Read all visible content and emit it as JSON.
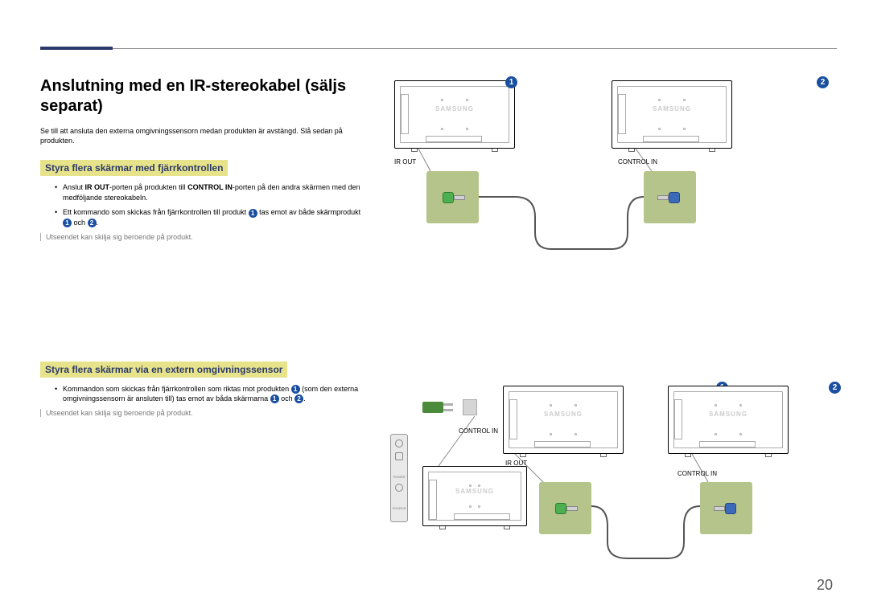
{
  "heading": "Anslutning med en IR-stereokabel (säljs separat)",
  "intro": "Se till att ansluta den externa omgivningssensorn medan produkten är avstängd. Slå sedan på produkten.",
  "section1": {
    "title": "Styra flera skärmar med fjärrkontrollen",
    "bullets": [
      {
        "pre": "Anslut ",
        "b1": "IR OUT",
        "mid": "-porten på produkten till ",
        "b2": "CONTROL IN",
        "post": "-porten på den andra skärmen med den medföljande stereokabeln."
      },
      {
        "pre": "Ett kommando som skickas från fjärrkontrollen till produkt ",
        "n1": "1",
        "mid": " tas emot av både skärmprodukt ",
        "n2": "1",
        "mid2": " och ",
        "n3": "2",
        "post": "."
      }
    ],
    "note": "Utseendet kan skilja sig beroende på produkt."
  },
  "section2": {
    "title": "Styra flera skärmar via en extern omgivningssensor",
    "bullets": [
      {
        "pre": "Kommandon som skickas från fjärrkontrollen som riktas mot produkten ",
        "n1": "1",
        "mid": " (som den externa omgivningssensorn är ansluten till) tas emot av båda skärmarna ",
        "n2": "1",
        "mid2": " och ",
        "n3": "2",
        "post": "."
      }
    ],
    "note": "Utseendet kan skilja sig beroende på produkt."
  },
  "labels": {
    "ir_out": "IR OUT",
    "control_in": "CONTROL IN",
    "brand": "SAMSUNG",
    "power": "POWER",
    "source": "SOURCE"
  },
  "badges": {
    "one": "1",
    "two": "2"
  },
  "page_number": "20"
}
